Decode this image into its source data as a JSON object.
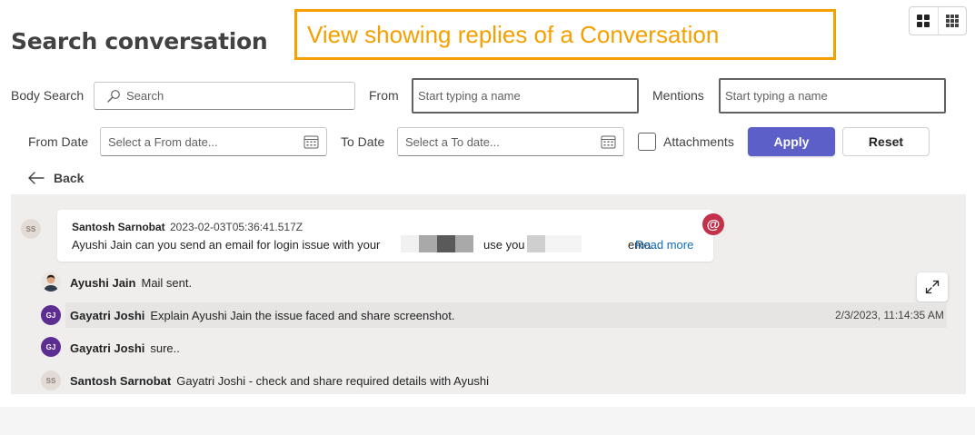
{
  "header": {
    "title": "Search conversation",
    "callout": "View showing replies of a Conversation",
    "view_toggle": {
      "grid_icon": "grid-2x2-icon",
      "apps_icon": "grid-3x3-icon"
    }
  },
  "filters": {
    "body_search_label": "Body Search",
    "search_placeholder": "Search",
    "from_label": "From",
    "from_placeholder": "Start typing a name",
    "mentions_label": "Mentions",
    "mentions_placeholder": "Start typing a name",
    "from_date_label": "From Date",
    "from_date_placeholder": "Select a From date...",
    "to_date_label": "To Date",
    "to_date_placeholder": "Select a To date...",
    "attachments_label": "Attachments",
    "attachments_checked": false,
    "apply_label": "Apply",
    "reset_label": "Reset"
  },
  "nav": {
    "back_label": "Back"
  },
  "conversation": {
    "message": {
      "avatar_initials": "SS",
      "author": "Santosh Sarnobat",
      "timestamp": "2023-02-03T05:36:41.517Z",
      "body_part1": "Ayushi Jain can you send an email for login issue with your",
      "body_part2": "use you",
      "body_part3": "ema...",
      "read_more": "Read more",
      "mention_badge": "@"
    },
    "replies": [
      {
        "avatar": "photo",
        "author": "Ayushi Jain",
        "text": "Mail sent.",
        "time": ""
      },
      {
        "avatar": "GJ",
        "author": "Gayatri Joshi",
        "text": "Explain Ayushi Jain the issue faced and share screenshot.",
        "time": "2/3/2023, 11:14:35 AM"
      },
      {
        "avatar": "GJ",
        "author": "Gayatri Joshi",
        "text": "sure..",
        "time": ""
      },
      {
        "avatar": "SS",
        "author": "Santosh Sarnobat",
        "text": "Gayatri Joshi - check and share required details with Ayushi",
        "time": ""
      }
    ]
  },
  "colors": {
    "accent": "#5b5fc7",
    "callout": "#f5a000",
    "mention": "#c4314b",
    "link": "#0f6cbd",
    "panel": "#efeeed"
  }
}
